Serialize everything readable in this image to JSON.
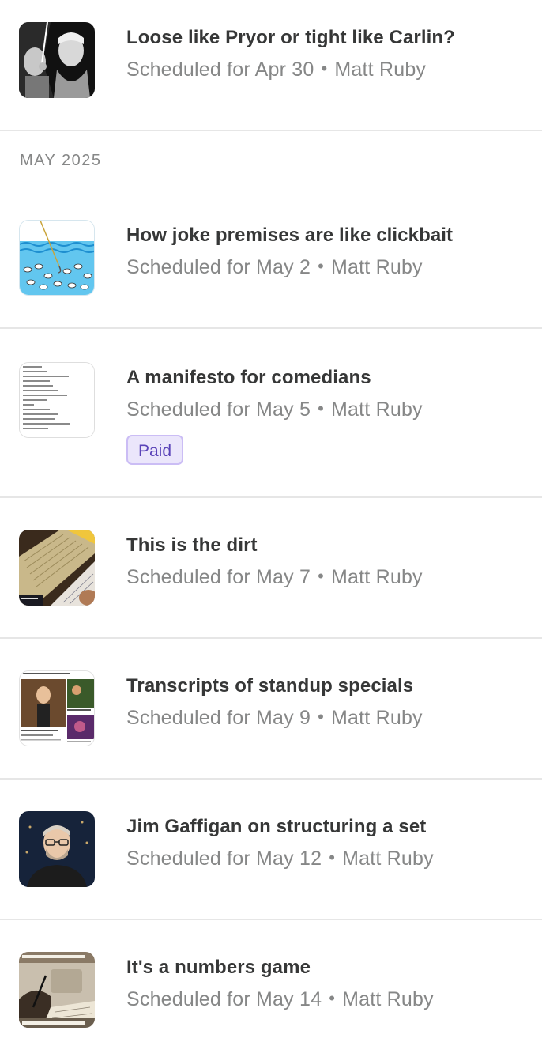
{
  "months": [
    {
      "label": "MAY 2025"
    }
  ],
  "posts": [
    {
      "title": "Loose like Pryor or tight like Carlin?",
      "scheduled": "Scheduled for Apr 30",
      "author": "Matt Ruby",
      "thumbnail_icon": "comedians-photo-icon"
    },
    {
      "title": "How joke premises are like clickbait",
      "scheduled": "Scheduled for May 2",
      "author": "Matt Ruby",
      "thumbnail_icon": "fishing-hook-icon"
    },
    {
      "title": "A manifesto for comedians",
      "scheduled": "Scheduled for May 5",
      "author": "Matt Ruby",
      "badge": "Paid",
      "thumbnail_icon": "manifesto-text-icon"
    },
    {
      "title": "This is the dirt",
      "scheduled": "Scheduled for May 7",
      "author": "Matt Ruby",
      "thumbnail_icon": "notebook-photo-icon"
    },
    {
      "title": "Transcripts of standup specials",
      "scheduled": "Scheduled for May 9",
      "author": "Matt Ruby",
      "thumbnail_icon": "transcripts-collage-icon"
    },
    {
      "title": "Jim Gaffigan on structuring a set",
      "scheduled": "Scheduled for May 12",
      "author": "Matt Ruby",
      "thumbnail_icon": "portrait-photo-icon"
    },
    {
      "title": "It's a numbers game",
      "scheduled": "Scheduled for May 14",
      "author": "Matt Ruby",
      "thumbnail_icon": "writing-session-photo-icon"
    }
  ],
  "separator": "•",
  "colors": {
    "title": "#363737",
    "meta": "#868787",
    "badge_bg": "#ebe6fb",
    "badge_border": "#cbbdf5",
    "badge_text": "#5a43b8",
    "divider": "#e6e6e6"
  }
}
